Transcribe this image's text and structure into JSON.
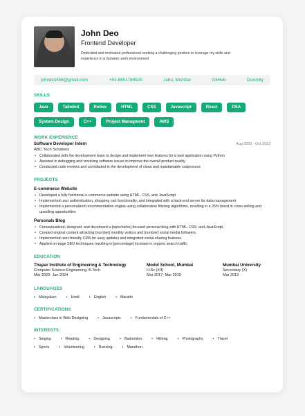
{
  "profile": {
    "name": "John Deo",
    "role": "Frontend Developer",
    "summary": "Dedicated and motivated professional seeking a challenging position to leverage my skills and experience in a dynamic work environment"
  },
  "contact": {
    "email": "johndeo456@gmail.com",
    "phone": "+91-8651788525",
    "location": "Juhu, Mumbai",
    "github": "GitHub",
    "doximity": "Doximity"
  },
  "skills": {
    "title": "SKILLS",
    "items": [
      "Java",
      "Tailwind",
      "Redux",
      "HTML",
      "CSS",
      "Javascript",
      "React",
      "DSA",
      "System Design",
      "C++",
      "Project Managment",
      "AWS"
    ]
  },
  "experience": {
    "title": "WORK EXPERIENCE",
    "job_title": "Software Developer Intern",
    "company": "ABC Tech Solutions",
    "date": "Aug 2023 - Oct 2023",
    "bullets": [
      "Collaborated with the development team to design and implement new features for a web application using Python",
      "Assisted in debugging and resolving software issues to improve the overall product quality",
      "Conducted code reviews and contributed to the development of clean and maintainable codprocess"
    ]
  },
  "projects": {
    "title": "PROJECTS",
    "p1": {
      "name": "E-commerce Website",
      "bullets": [
        "Developed a fully functional e-commerce website using HTML, CSS, and JavaScript",
        "Implemented user authentication, shopping cart functionality, and integrated with a back-end server for data management",
        "Implemented a personalized recommendation engine using collaborative filtering algorithms, resulting in a 25% boost in cross-selling and upselling opportunities"
      ]
    },
    "p2": {
      "name": "Personals Blog",
      "bullets": [
        "Conceptualized, designed, and developed a [topic/niche]-focused personal blog with HTML, CSS, and JavaScript.",
        "Created original content attracting [number] monthly visitors and [number] social media followers.",
        "Implemented user-friendly CMS for easy updates and integrated social sharing features.",
        "Applied on-page SEO techniques resulting in [percentage] increase in organic search traffic"
      ]
    }
  },
  "education": {
    "title": "EDUCATION",
    "e1": {
      "school": "Thapar Institute of Engineering & Technology",
      "degree": "Computer Science Engineering, B.Tech",
      "date": "Mar 2020- Jun 2024"
    },
    "e2": {
      "school": "Model School, Mumbai",
      "degree": "H.Sc (XII)",
      "date": "Mar 2017- Mar 2019"
    },
    "e3": {
      "school": "Mumbai University",
      "degree": "Secondary (X)",
      "date": "Mar 2019"
    }
  },
  "languages": {
    "title": "LANGUAGES",
    "items": [
      "Malayalam",
      "Hindi",
      "English",
      "Marathi"
    ]
  },
  "certifications": {
    "title": "CERTIFICATIONS",
    "items": [
      "Masterclass in Web Designing",
      "Javascripts",
      "Fundamentals of C++"
    ]
  },
  "interests": {
    "title": "INTERESTS",
    "items": [
      "Singing",
      "Reading",
      "Designing",
      "Badminton",
      "Hikkng",
      "Photography",
      "Travel",
      "Sports",
      "Volunteering",
      "Running",
      "Marathon"
    ]
  }
}
